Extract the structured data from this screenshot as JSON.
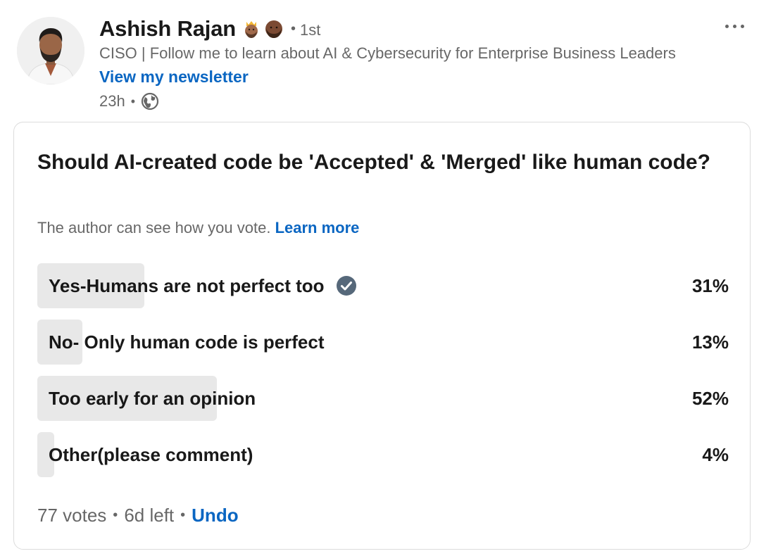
{
  "post": {
    "author": {
      "name": "Ashish Rajan",
      "emojis": [
        "crown-person-emoji",
        "bearded-person-emoji"
      ],
      "connection_sep": "•",
      "connection_degree": "1st",
      "headline": "CISO | Follow me to learn about AI & Cybersecurity for Enterprise Business Leaders",
      "newsletter_link": "View my newsletter",
      "avatar_icon": "avatar-photo"
    },
    "meta": {
      "time_ago": "23h",
      "sep": "•",
      "visibility_icon": "globe-icon"
    },
    "more_menu_icon": "more-horizontal-icon"
  },
  "poll": {
    "question": "Should AI-created code be 'Accepted' & 'Merged' like human code?",
    "notice_text": "The author can see how you vote.",
    "notice_link": "Learn more",
    "options": [
      {
        "label": "Yes-Humans are not perfect too",
        "percent_text": "31%",
        "percent": 31,
        "selected": true
      },
      {
        "label": "No- Only human code is perfect",
        "percent_text": "13%",
        "percent": 13,
        "selected": false
      },
      {
        "label": "Too early for an opinion",
        "percent_text": "52%",
        "percent": 52,
        "selected": false
      },
      {
        "label": "Other(please comment)",
        "percent_text": "4%",
        "percent": 4,
        "selected": false
      }
    ],
    "footer": {
      "votes": "77 votes",
      "sep": "•",
      "time_left": "6d left",
      "undo": "Undo"
    }
  },
  "colors": {
    "link_blue": "#0a66c2",
    "bar_gray": "#e8e8e8",
    "check_badge": "#56687a"
  }
}
